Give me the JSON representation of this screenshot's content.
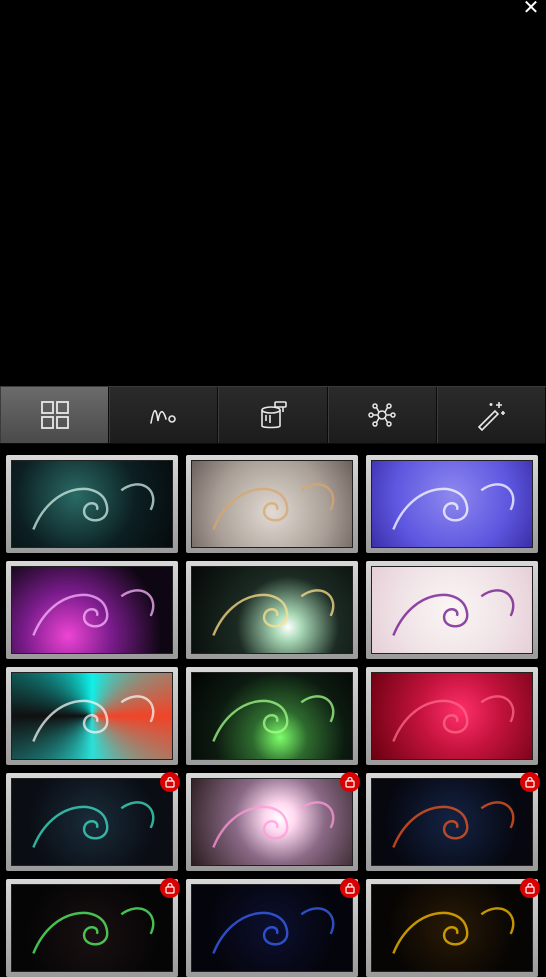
{
  "window": {
    "close_icon": "close-icon",
    "close_glyph": "✕"
  },
  "toolbar": {
    "tabs": [
      {
        "name": "grid-icon",
        "active": true
      },
      {
        "name": "squiggle-icon",
        "active": false
      },
      {
        "name": "paint-bucket-icon",
        "active": false
      },
      {
        "name": "network-icon",
        "active": false
      },
      {
        "name": "magic-wand-icon",
        "active": false
      }
    ]
  },
  "presets": [
    {
      "locked": false,
      "bg": "radial-gradient(circle at 40% 40%, #2a6b66 0%, #0c1f22 55%, #050a0c 100%)",
      "accent": "#cfeee6"
    },
    {
      "locked": false,
      "bg": "radial-gradient(circle at 50% 60%, #e2dbd3 0%, #a89e96 60%, #6d605c 100%)",
      "accent": "#d8a66c"
    },
    {
      "locked": false,
      "bg": "radial-gradient(circle at 50% 40%, #8e88f0 0%, #5e57e0 60%, #3a2ea8 100%)",
      "accent": "#ffffff"
    },
    {
      "locked": false,
      "bg": "radial-gradient(circle at 35% 80%, #ee44d4 0%, #7a1c8c 35%, #0e0612 75%)",
      "accent": "#f9b6ff"
    },
    {
      "locked": false,
      "bg": "radial-gradient(circle at 60% 70%, #ffffff 0%, #a8d8b6 12%, #1b2a22 45%, #050807 100%)",
      "accent": "#ffe08a"
    },
    {
      "locked": false,
      "bg": "radial-gradient(circle at 50% 50%, #fbf6f4 0%, #efe2e6 60%, #e7cfd8 100%)",
      "accent": "#6b0c8a"
    },
    {
      "locked": false,
      "bg": "conic-gradient(from 0deg at 50% 50%, #0ff0e8, #f04428, #2ae0d8, #101010, #0ff0e8)",
      "accent": "#f4f4f4"
    },
    {
      "locked": false,
      "bg": "radial-gradient(circle at 55% 75%, #7cff6a 0%, #2e6a2e 25%, #0c1a10 60%, #020402 100%)",
      "accent": "#a6ff8c"
    },
    {
      "locked": false,
      "bg": "radial-gradient(circle at 55% 45%, #ff2f6a 0%, #c4133d 40%, #6a0010 100%)",
      "accent": "#ff6a8a"
    },
    {
      "locked": true,
      "bg": "radial-gradient(circle at 50% 50%, #1a2c3a 0%, #0a0d14 70%)",
      "accent": "#3fe6c8"
    },
    {
      "locked": true,
      "bg": "radial-gradient(circle at 55% 45%, #ffffff 0%, #ffd8f0 15%, #8a6a86 45%, #2a1c1e 100%)",
      "accent": "#ff9ad8"
    },
    {
      "locked": true,
      "bg": "radial-gradient(circle at 50% 50%, #142344 0%, #06070f 75%)",
      "accent": "#f25a20"
    },
    {
      "locked": true,
      "bg": "radial-gradient(circle at 50% 60%, #1a1012 0%, #050505 70%)",
      "accent": "#5aff6a"
    },
    {
      "locked": true,
      "bg": "radial-gradient(circle at 50% 50%, #0c1030 0%, #04050c 70%)",
      "accent": "#3a66ff"
    },
    {
      "locked": true,
      "bg": "radial-gradient(circle at 50% 50%, #2a1a06 0%, #070503 70%)",
      "accent": "#ffc400"
    }
  ],
  "lock_icon": "lock-icon"
}
